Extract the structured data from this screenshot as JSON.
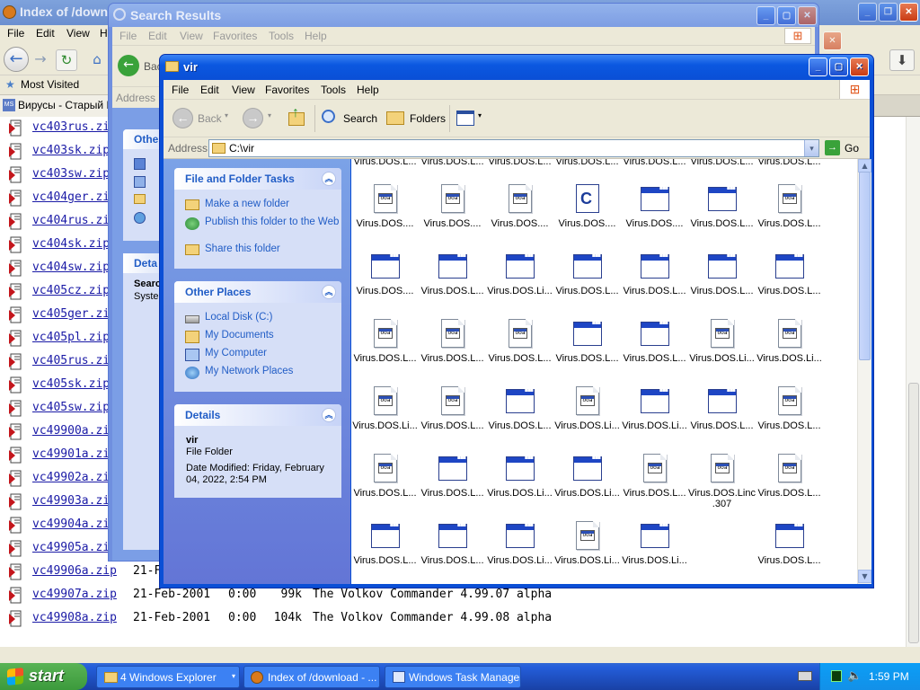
{
  "firefox": {
    "title": "Index of /downl",
    "menu": [
      "File",
      "Edit",
      "View",
      "H"
    ],
    "bookmark": "Most Visited",
    "tab": "Вирусы - Старый D",
    "listing": [
      {
        "name": "vc403rus.zip"
      },
      {
        "name": "vc403sk.zip"
      },
      {
        "name": "vc403sw.zip"
      },
      {
        "name": "vc404ger.zip"
      },
      {
        "name": "vc404rus.zip"
      },
      {
        "name": "vc404sk.zip"
      },
      {
        "name": "vc404sw.zip"
      },
      {
        "name": "vc405cz.zip"
      },
      {
        "name": "vc405ger.zip"
      },
      {
        "name": "vc405pl.zip"
      },
      {
        "name": "vc405rus.zip"
      },
      {
        "name": "vc405sk.zip"
      },
      {
        "name": "vc405sw.zip"
      },
      {
        "name": "vc49900a.zip"
      },
      {
        "name": "vc49901a.zip"
      },
      {
        "name": "vc49902a.zip"
      },
      {
        "name": "vc49903a.zip"
      },
      {
        "name": "vc49904a.zip"
      },
      {
        "name": "vc49905a.zip"
      },
      {
        "name": "vc49906a.zip",
        "date": "21-F"
      },
      {
        "name": "vc49907a.zip",
        "date": "21-Feb-2001",
        "time": "0:00",
        "size": "99k",
        "desc": "The Volkov Commander 4.99.07 alpha"
      },
      {
        "name": "vc49908a.zip",
        "date": "21-Feb-2001",
        "time": "0:00",
        "size": "104k",
        "desc": "The Volkov Commander 4.99.08 alpha"
      }
    ]
  },
  "search_window": {
    "title": "Search Results",
    "menu": [
      "File",
      "Edit",
      "View",
      "Favorites",
      "Tools",
      "Help"
    ],
    "back_label": "Bac",
    "address_label": "Address",
    "panel_other": "Othe",
    "panel_details": "Deta",
    "panel_details_line1": "Searc",
    "panel_details_line2": "Syste"
  },
  "explorer": {
    "title": "vir",
    "menu": [
      "File",
      "Edit",
      "View",
      "Favorites",
      "Tools",
      "Help"
    ],
    "toolbar": {
      "back": "Back",
      "search": "Search",
      "folders": "Folders"
    },
    "address_label": "Address",
    "address_value": "C:\\vir",
    "go_label": "Go",
    "tasks_panel": {
      "title": "File and Folder Tasks",
      "items": [
        "Make a new folder",
        "Publish this folder to the Web",
        "Share this folder"
      ]
    },
    "places_panel": {
      "title": "Other Places",
      "items": [
        "Local Disk (C:)",
        "My Documents",
        "My Computer",
        "My Network Places"
      ]
    },
    "details_panel": {
      "title": "Details",
      "name": "vir",
      "type": "File Folder",
      "modified": "Date Modified: Friday, February 04, 2022, 2:54 PM"
    },
    "top_labels": [
      "Virus.DOS.L...",
      "Virus.DOS.L...",
      "Virus.DOS.L...",
      "Virus.DOS.L...",
      "Virus.DOS.L...",
      "Virus.DOS.L...",
      "Virus.DOS.L..."
    ],
    "files": [
      [
        {
          "i": "doc",
          "l": "Virus.DOS...."
        },
        {
          "i": "doc",
          "l": "Virus.DOS...."
        },
        {
          "i": "doc",
          "l": "Virus.DOS...."
        },
        {
          "i": "c",
          "l": "Virus.DOS...."
        },
        {
          "i": "app",
          "l": "Virus.DOS...."
        },
        {
          "i": "app",
          "l": "Virus.DOS.L..."
        },
        {
          "i": "doc",
          "l": "Virus.DOS.L..."
        }
      ],
      [
        {
          "i": "app",
          "l": "Virus.DOS...."
        },
        {
          "i": "app",
          "l": "Virus.DOS.L..."
        },
        {
          "i": "app",
          "l": "Virus.DOS.Li..."
        },
        {
          "i": "app",
          "l": "Virus.DOS.L..."
        },
        {
          "i": "app",
          "l": "Virus.DOS.L..."
        },
        {
          "i": "app",
          "l": "Virus.DOS.L..."
        },
        {
          "i": "app",
          "l": "Virus.DOS.L..."
        }
      ],
      [
        {
          "i": "doc",
          "l": "Virus.DOS.L..."
        },
        {
          "i": "doc",
          "l": "Virus.DOS.L..."
        },
        {
          "i": "doc",
          "l": "Virus.DOS.L..."
        },
        {
          "i": "app",
          "l": "Virus.DOS.L..."
        },
        {
          "i": "app",
          "l": "Virus.DOS.L..."
        },
        {
          "i": "doc",
          "l": "Virus.DOS.Li..."
        },
        {
          "i": "doc",
          "l": "Virus.DOS.Li..."
        }
      ],
      [
        {
          "i": "doc",
          "l": "Virus.DOS.Li..."
        },
        {
          "i": "doc",
          "l": "Virus.DOS.L..."
        },
        {
          "i": "app",
          "l": "Virus.DOS.L..."
        },
        {
          "i": "doc",
          "l": "Virus.DOS.Li..."
        },
        {
          "i": "app",
          "l": "Virus.DOS.Li..."
        },
        {
          "i": "app",
          "l": "Virus.DOS.L..."
        },
        {
          "i": "doc",
          "l": "Virus.DOS.L..."
        }
      ],
      [
        {
          "i": "doc",
          "l": "Virus.DOS.L..."
        },
        {
          "i": "app",
          "l": "Virus.DOS.L..."
        },
        {
          "i": "app",
          "l": "Virus.DOS.Li..."
        },
        {
          "i": "app",
          "l": "Virus.DOS.Li..."
        },
        {
          "i": "doc",
          "l": "Virus.DOS.L..."
        },
        {
          "i": "doc",
          "l": "Virus.DOS.Linc .307"
        },
        {
          "i": "doc",
          "l": "Virus.DOS.L..."
        }
      ],
      [
        {
          "i": "app",
          "l": "Virus.DOS.L..."
        },
        {
          "i": "app",
          "l": "Virus.DOS.L..."
        },
        {
          "i": "app",
          "l": "Virus.DOS.Li..."
        },
        {
          "i": "doc",
          "l": "Virus.DOS.Li..."
        },
        {
          "i": "app",
          "l": "Virus.DOS.Li..."
        },
        null,
        {
          "i": "app",
          "l": "Virus.DOS.L..."
        }
      ]
    ]
  },
  "taskbar": {
    "start": "start",
    "buttons": [
      "4 Windows Explorer",
      "Index of /download - ...",
      "Windows Task Manager"
    ],
    "clock": "1:59 PM"
  },
  "colors": {
    "xp_blue": "#0a4fd6",
    "task_link": "#215dc6",
    "start_green": "#3c9a3c"
  }
}
